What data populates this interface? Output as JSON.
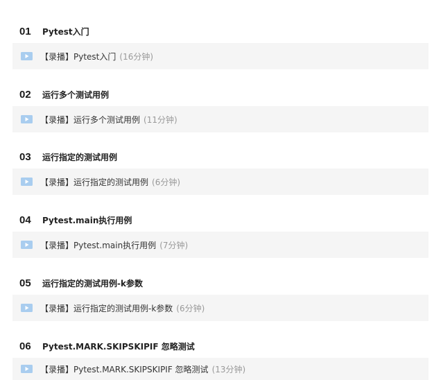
{
  "colors": {
    "icon": "#a9cdef",
    "row_background": "#f5f5f5",
    "duration_text": "#999999"
  },
  "chapters": [
    {
      "number": "01",
      "title": "Pytest入门",
      "lesson": {
        "title": "【录播】Pytest入门",
        "duration": "(16分钟)",
        "icon": "video-play-icon"
      }
    },
    {
      "number": "02",
      "title": "运行多个测试用例",
      "lesson": {
        "title": "【录播】运行多个测试用例",
        "duration": "(11分钟)",
        "icon": "video-play-icon"
      }
    },
    {
      "number": "03",
      "title": "运行指定的测试用例",
      "lesson": {
        "title": "【录播】运行指定的测试用例",
        "duration": "(6分钟)",
        "icon": "video-play-icon"
      }
    },
    {
      "number": "04",
      "title": "Pytest.main执行用例",
      "lesson": {
        "title": "【录播】Pytest.main执行用例",
        "duration": "(7分钟)",
        "icon": "video-play-icon"
      }
    },
    {
      "number": "05",
      "title": "运行指定的测试用例-k参数",
      "lesson": {
        "title": "【录播】运行指定的测试用例-k参数",
        "duration": "(6分钟)",
        "icon": "video-play-icon"
      }
    },
    {
      "number": "06",
      "title": "Pytest.MARK.SKIPSKIPIF 忽略测试",
      "lesson": {
        "title": "【录播】Pytest.MARK.SKIPSKIPIF 忽略测试",
        "duration": "(13分钟)",
        "icon": "video-play-icon"
      }
    }
  ]
}
